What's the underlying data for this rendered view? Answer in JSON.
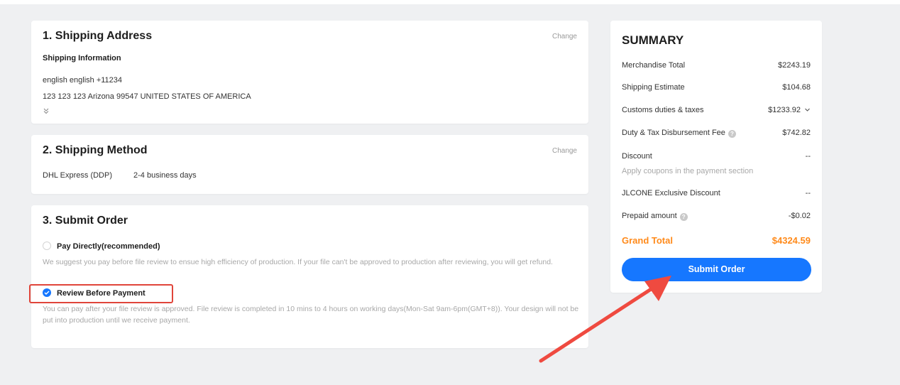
{
  "shipping_address": {
    "title": "1. Shipping Address",
    "change_label": "Change",
    "info_heading": "Shipping Information",
    "name_phone": "english english +11234",
    "address": "123 123 123 Arizona 99547 UNITED STATES OF AMERICA",
    "expand_icon": "double-chevron-down-icon"
  },
  "shipping_method": {
    "title": "2. Shipping Method",
    "change_label": "Change",
    "carrier": "DHL Express (DDP)",
    "delivery_time": "2-4 business days"
  },
  "submit_order": {
    "title": "3. Submit Order",
    "options": [
      {
        "label": "Pay Directly(recommended)",
        "selected": false,
        "description": "We suggest you pay before file review to ensue high efficiency of production. If your file can't be approved to production after reviewing, you will get refund."
      },
      {
        "label": "Review Before Payment",
        "selected": true,
        "description": "You can pay after your file review is approved. File review is completed in 10 mins to 4 hours on working days(Mon-Sat 9am-6pm(GMT+8)). Your design will not be put into production until we receive payment."
      }
    ]
  },
  "summary": {
    "title": "SUMMARY",
    "rows": [
      {
        "label": "Merchandise Total",
        "value": "$2243.19"
      },
      {
        "label": "Shipping Estimate",
        "value": "$104.68"
      },
      {
        "label": "Customs duties & taxes",
        "value": "$1233.92"
      },
      {
        "label": "Duty & Tax Disbursement Fee",
        "value": "$742.82"
      },
      {
        "label": "Discount",
        "value": "--",
        "note": "Apply coupons in the payment section"
      },
      {
        "label": "JLCONE Exclusive Discount",
        "value": "--"
      },
      {
        "label": "Prepaid amount",
        "value": "-$0.02"
      }
    ],
    "grand_total_label": "Grand Total",
    "grand_total_value": "$4324.59",
    "submit_label": "Submit Order"
  },
  "colors": {
    "accent_blue": "#1677ff",
    "grand_total_orange": "#ff8a1a",
    "annotation_red": "#e0453a"
  }
}
